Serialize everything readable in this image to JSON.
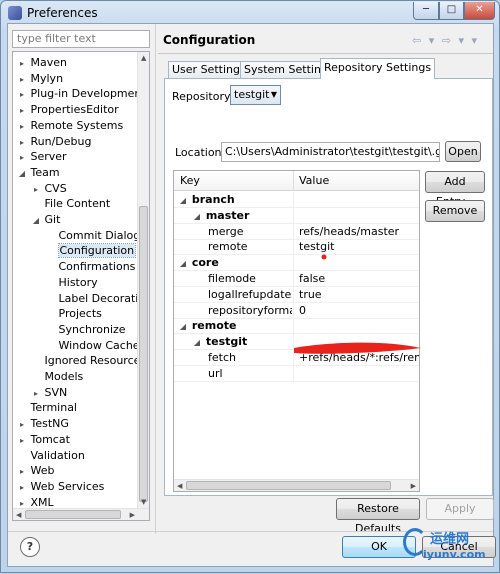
{
  "window": {
    "title": "Preferences"
  },
  "title_buttons": {
    "minimize": "─",
    "maximize": "□",
    "close": "✕"
  },
  "filter": {
    "placeholder": "type filter text"
  },
  "tree": [
    {
      "label": "Maven",
      "depth": 1,
      "twisty": "▸"
    },
    {
      "label": "Mylyn",
      "depth": 1,
      "twisty": "▸"
    },
    {
      "label": "Plug-in Development",
      "depth": 1,
      "twisty": "▸"
    },
    {
      "label": "PropertiesEditor",
      "depth": 1,
      "twisty": "▸"
    },
    {
      "label": "Remote Systems",
      "depth": 1,
      "twisty": "▸"
    },
    {
      "label": "Run/Debug",
      "depth": 1,
      "twisty": "▸"
    },
    {
      "label": "Server",
      "depth": 1,
      "twisty": "▸"
    },
    {
      "label": "Team",
      "depth": 1,
      "twisty": "◢"
    },
    {
      "label": "CVS",
      "depth": 2,
      "twisty": "▸"
    },
    {
      "label": "File Content",
      "depth": 2,
      "twisty": ""
    },
    {
      "label": "Git",
      "depth": 2,
      "twisty": "◢"
    },
    {
      "label": "Commit Dialog",
      "depth": 3,
      "twisty": ""
    },
    {
      "label": "Configuration",
      "depth": 3,
      "twisty": "",
      "selected": true
    },
    {
      "label": "Confirmations and",
      "depth": 3,
      "twisty": ""
    },
    {
      "label": "History",
      "depth": 3,
      "twisty": ""
    },
    {
      "label": "Label Decorations",
      "depth": 3,
      "twisty": ""
    },
    {
      "label": "Projects",
      "depth": 3,
      "twisty": ""
    },
    {
      "label": "Synchronize",
      "depth": 3,
      "twisty": ""
    },
    {
      "label": "Window Cache",
      "depth": 3,
      "twisty": ""
    },
    {
      "label": "Ignored Resources",
      "depth": 2,
      "twisty": ""
    },
    {
      "label": "Models",
      "depth": 2,
      "twisty": ""
    },
    {
      "label": "SVN",
      "depth": 2,
      "twisty": "▸"
    },
    {
      "label": "Terminal",
      "depth": 1,
      "twisty": ""
    },
    {
      "label": "TestNG",
      "depth": 1,
      "twisty": "▸"
    },
    {
      "label": "Tomcat",
      "depth": 1,
      "twisty": "▸"
    },
    {
      "label": "Validation",
      "depth": 1,
      "twisty": ""
    },
    {
      "label": "Web",
      "depth": 1,
      "twisty": "▸"
    },
    {
      "label": "Web Services",
      "depth": 1,
      "twisty": "▸"
    },
    {
      "label": "XML",
      "depth": 1,
      "twisty": "▸"
    }
  ],
  "page": {
    "title": "Configuration",
    "nav": "⇦ ▾ ⇨ ▾ ▾"
  },
  "tabs": [
    "User Settings",
    "System Settings",
    "Repository Settings"
  ],
  "active_tab": 2,
  "repository": {
    "label": "Repository:",
    "value": "testgit",
    "arrow": "▼"
  },
  "location": {
    "label": "Location:",
    "value": "C:\\Users\\Administrator\\testgit\\testgit\\.git\\confi",
    "open_label": "Open"
  },
  "grid": {
    "headers": [
      "Key",
      "Value"
    ],
    "rows": [
      {
        "key": "branch",
        "value": "",
        "level": 0,
        "twisty": "◢",
        "section": true
      },
      {
        "key": "master",
        "value": "",
        "level": 1,
        "twisty": "◢",
        "section": true
      },
      {
        "key": "merge",
        "value": "refs/heads/master",
        "level": 2,
        "twisty": ""
      },
      {
        "key": "remote",
        "value": "testgit",
        "level": 2,
        "twisty": ""
      },
      {
        "key": "core",
        "value": "",
        "level": 0,
        "twisty": "◢",
        "section": true
      },
      {
        "key": "filemode",
        "value": "false",
        "level": 2,
        "twisty": ""
      },
      {
        "key": "logallrefupdates",
        "value": "true",
        "level": 2,
        "twisty": ""
      },
      {
        "key": "repositoryformatversion",
        "value": "0",
        "level": 2,
        "twisty": ""
      },
      {
        "key": "remote",
        "value": "",
        "level": 0,
        "twisty": "◢",
        "section": true
      },
      {
        "key": "testgit",
        "value": "",
        "level": 1,
        "twisty": "◢",
        "section": true
      },
      {
        "key": "fetch",
        "value": "+refs/heads/*:refs/remotes/testgit/*",
        "level": 2,
        "twisty": ""
      },
      {
        "key": "url",
        "value": "",
        "level": 2,
        "twisty": "",
        "selected": true
      }
    ]
  },
  "buttons": {
    "add_entry": "Add Entry...",
    "remove": "Remove",
    "restore_defaults": "Restore Defaults",
    "apply": "Apply",
    "ok": "OK",
    "cancel": "Cancel",
    "help": "?"
  },
  "watermark": {
    "cn": "运维网",
    "url": "iyunv.com"
  },
  "colors": {
    "annotation_red": "#e8231c",
    "selection": "#dde8f6",
    "watermark_blue": "#2a7ad0"
  }
}
